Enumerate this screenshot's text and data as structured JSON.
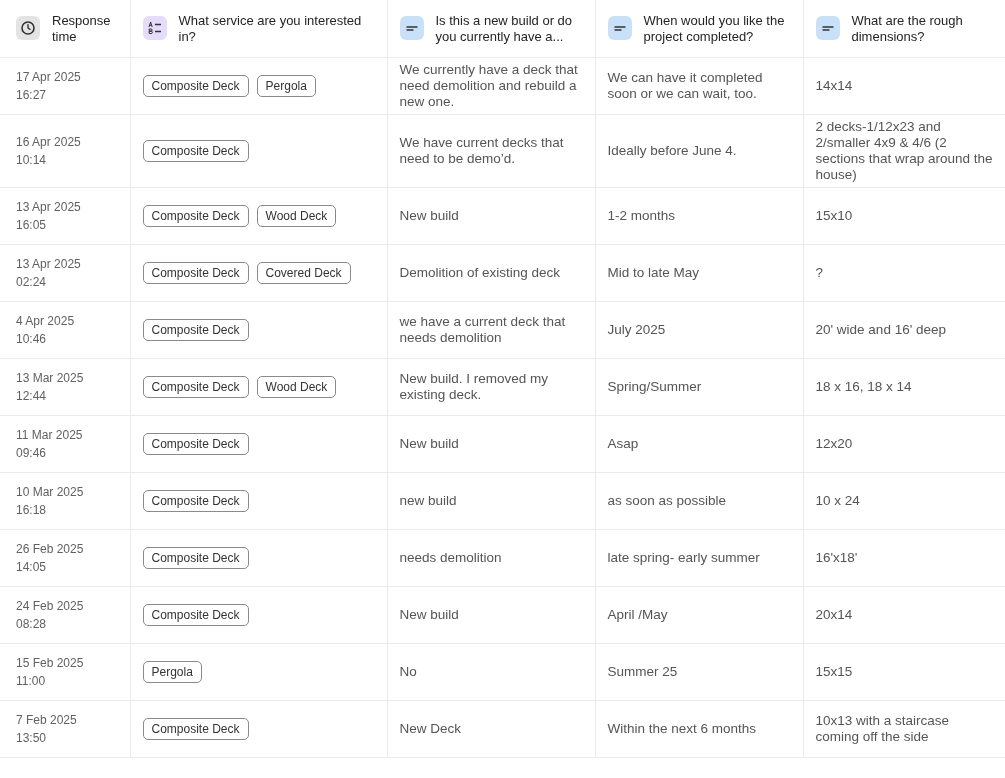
{
  "table": {
    "columns": [
      {
        "label": "Response time",
        "kind": "date"
      },
      {
        "label": "What service are you interested in?",
        "kind": "choice"
      },
      {
        "label": "Is this a new build or do you currently have a...",
        "kind": "text"
      },
      {
        "label": "When would you like the project completed?",
        "kind": "text"
      },
      {
        "label": "What are the rough dimensions?",
        "kind": "text"
      }
    ],
    "rows": [
      {
        "date": "17 Apr 2025",
        "time": "16:27",
        "services": [
          "Composite Deck",
          "Pergola"
        ],
        "build": "We currently have a deck that need demolition and rebuild a new one.",
        "when": "We can have it completed soon or we can wait, too.",
        "dimensions": "14x14"
      },
      {
        "date": "16 Apr 2025",
        "time": "10:14",
        "services": [
          "Composite Deck"
        ],
        "build": "We have current decks that need to be demo’d.",
        "when": "Ideally before June 4.",
        "dimensions": "2 decks-1/12x23 and 2/smaller 4x9 & 4/6 (2 sections that wrap around the house)"
      },
      {
        "date": "13 Apr 2025",
        "time": "16:05",
        "services": [
          "Composite Deck",
          "Wood Deck"
        ],
        "build": "New build",
        "when": "1-2 months",
        "dimensions": "15x10"
      },
      {
        "date": "13 Apr 2025",
        "time": "02:24",
        "services": [
          "Composite Deck",
          "Covered Deck"
        ],
        "build": "Demolition of existing deck",
        "when": "Mid to late May",
        "dimensions": "?"
      },
      {
        "date": "4 Apr 2025",
        "time": "10:46",
        "services": [
          "Composite Deck"
        ],
        "build": "we have a current deck that needs demolition",
        "when": "July 2025",
        "dimensions": "20' wide and 16' deep"
      },
      {
        "date": "13 Mar 2025",
        "time": "12:44",
        "services": [
          "Composite Deck",
          "Wood Deck"
        ],
        "build": "New build. I removed my existing deck.",
        "when": "Spring/Summer",
        "dimensions": "18 x 16, 18 x 14"
      },
      {
        "date": "11 Mar 2025",
        "time": "09:46",
        "services": [
          "Composite Deck"
        ],
        "build": "New build",
        "when": "Asap",
        "dimensions": "12x20"
      },
      {
        "date": "10 Mar 2025",
        "time": "16:18",
        "services": [
          "Composite Deck"
        ],
        "build": "new build",
        "when": "as soon as possible",
        "dimensions": "10 x 24"
      },
      {
        "date": "26 Feb 2025",
        "time": "14:05",
        "services": [
          "Composite Deck"
        ],
        "build": "needs demolition",
        "when": "late spring- early summer",
        "dimensions": "16'x18'"
      },
      {
        "date": "24 Feb 2025",
        "time": "08:28",
        "services": [
          "Composite Deck"
        ],
        "build": "New build",
        "when": "April /May",
        "dimensions": "20x14"
      },
      {
        "date": "15 Feb 2025",
        "time": "11:00",
        "services": [
          "Pergola"
        ],
        "build": "No",
        "when": "Summer 25",
        "dimensions": "15x15"
      },
      {
        "date": "7 Feb 2025",
        "time": "13:50",
        "services": [
          "Composite Deck"
        ],
        "build": "New Deck",
        "when": "Within the next 6 months",
        "dimensions": "10x13 with a staircase coming off the side"
      }
    ]
  }
}
